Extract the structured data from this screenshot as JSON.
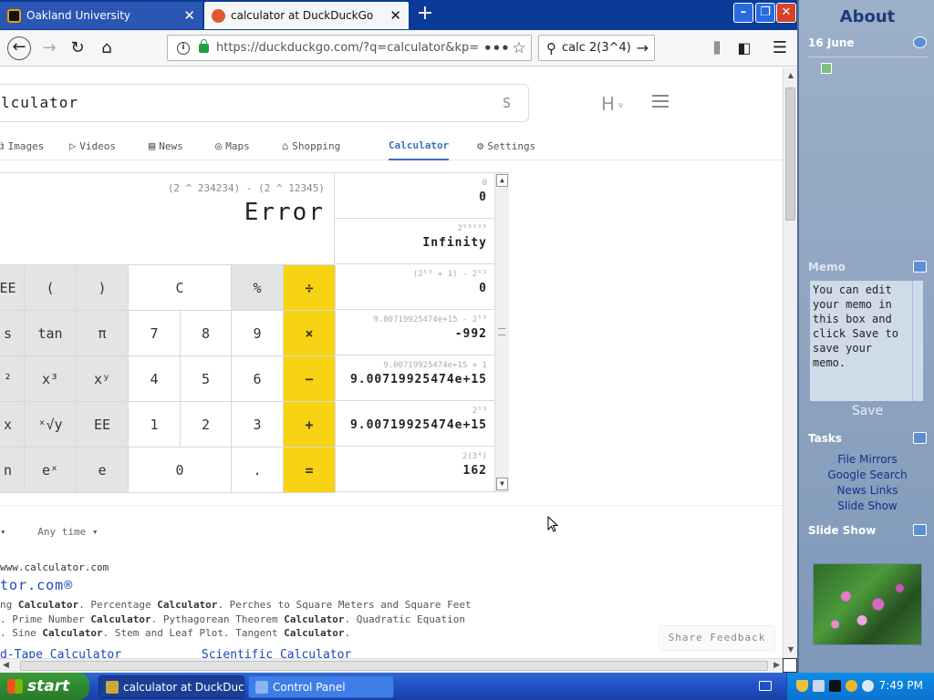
{
  "browser": {
    "tabs": [
      {
        "title": "Oakland University",
        "active": false
      },
      {
        "title": "calculator at DuckDuckGo",
        "active": true
      }
    ],
    "new_tab_symbol": "+",
    "window_buttons": {
      "minimize": "–",
      "maximize": "❐",
      "close": "✕"
    },
    "url": "https://duckduckgo.com/?q=calculator&kp=",
    "url_more": "•••",
    "search_box_value": "calc 2(3^4)"
  },
  "ddg": {
    "search_value": "lculator",
    "search_suffix": "S",
    "badge": "H",
    "badge_small": "ν",
    "tabs": [
      {
        "label": "Images",
        "icon": "⧉"
      },
      {
        "label": "Videos",
        "icon": "▷"
      },
      {
        "label": "News",
        "icon": "▤"
      },
      {
        "label": "Maps",
        "icon": "◎"
      },
      {
        "label": "Shopping",
        "icon": "⌂"
      },
      {
        "label": "Calculator",
        "icon": ""
      },
      {
        "label": "Settings",
        "icon": "⚙"
      }
    ],
    "active_tab": "Calculator"
  },
  "calculator": {
    "expression": "(2 ^ 234234) - (2 ^ 12345)",
    "result": "Error",
    "keys": [
      [
        "EE",
        "(",
        ")",
        "C",
        "%",
        "÷"
      ],
      [
        "s",
        "tan",
        "π",
        "7",
        "8",
        "9",
        "×"
      ],
      [
        "²",
        "x³",
        "xʸ",
        "4",
        "5",
        "6",
        "−"
      ],
      [
        "x",
        "ˣ√y",
        "EE",
        "1",
        "2",
        "3",
        "+"
      ],
      [
        "n",
        "eˣ",
        "e",
        "0",
        ".",
        "="
      ]
    ],
    "history": [
      {
        "expr": "0",
        "result": "0"
      },
      {
        "expr": "2⁹⁹⁹⁹⁹",
        "result": "Infinity"
      },
      {
        "expr": "(2⁵³ + 1) - 2⁵³",
        "result": "0"
      },
      {
        "expr": "9.00719925474e+15 - 2⁵³",
        "result": "-992"
      },
      {
        "expr": "9.00719925474e+15 + 1",
        "result": "9.00719925474e+15"
      },
      {
        "expr": "2⁵³",
        "result": "9.00719925474e+15"
      },
      {
        "expr": "2(3⁴)",
        "result": "162"
      }
    ]
  },
  "results": {
    "filter_region": "▾",
    "filter_time": "Any time ▾",
    "result_url": "www.calculator.com",
    "result_title": "tor.com®",
    "snippet_1_pre": "ng ",
    "snippet_1_b1": "Calculator",
    "snippet_1_mid": ". Percentage ",
    "snippet_1_b2": "Calculator",
    "snippet_1_post": ". Perches to Square Meters and Square Feet",
    "snippet_2_pre": ". Prime Number ",
    "snippet_2_b1": "Calculator",
    "snippet_2_mid": ". Pythagorean Theorem ",
    "snippet_2_b2": "Calculator",
    "snippet_2_post": ". Quadratic Equation",
    "snippet_3_pre": ". Sine ",
    "snippet_3_b1": "Calculator",
    "snippet_3_mid": ". Stem and Leaf Plot. Tangent ",
    "snippet_3_b2": "Calculator",
    "snippet_3_post": ".",
    "link_1": "d-Tape Calculator",
    "link_2": "Scientific Calculator",
    "share_feedback": "Share Feedback"
  },
  "sidebar": {
    "title": "About",
    "date": "16 June",
    "memo_heading": "Memo",
    "memo_text": "You can edit your memo in this box and click Save to save your memo.",
    "memo_save": "Save",
    "tasks_heading": "Tasks",
    "tasks": [
      "File Mirrors",
      "Google Search",
      "News Links",
      "Slide Show"
    ],
    "slideshow_heading": "Slide Show"
  },
  "taskbar": {
    "start": "start",
    "items": [
      "calculator at DuckDuc...",
      "Control Panel"
    ],
    "clock": "7:49 PM"
  },
  "colors": {
    "ddg_accent": "#3b6ec4",
    "calc_operator": "#f7d313",
    "xp_taskbar": "#245edb",
    "xp_start": "#3c9a3c",
    "firefox_tabbar": "#0a3b98"
  }
}
